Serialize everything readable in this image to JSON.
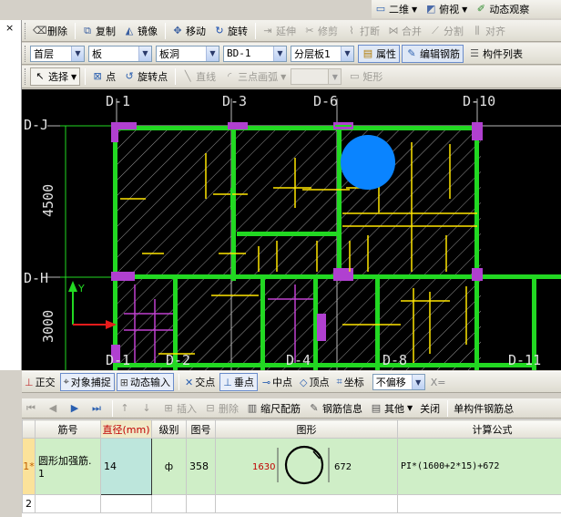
{
  "top_bar": {
    "view_combo": "二维",
    "view_mode": "俯视",
    "dynamic_observe": "动态观察"
  },
  "edit_bar": {
    "delete": "删除",
    "copy": "复制",
    "mirror": "镜像",
    "move": "移动",
    "rotate": "旋转",
    "extend": "延伸",
    "trim": "修剪",
    "break": "打断",
    "merge": "合并",
    "split": "分割",
    "align": "对齐"
  },
  "prop_bar": {
    "floor": "首层",
    "category": "板",
    "type": "板洞",
    "component": "BD-1",
    "layer": "分层板1",
    "properties": "属性",
    "edit_rebar": "编辑钢筋",
    "component_list": "构件列表"
  },
  "draw_bar": {
    "select": "选择",
    "point": "点",
    "rotate_point": "旋转点",
    "line": "直线",
    "arc": "三点画弧",
    "rect": "矩形"
  },
  "left_strip": {
    "close": "×"
  },
  "drawing": {
    "axis_top": [
      "D-1",
      "D-3",
      "D-6",
      "D-10"
    ],
    "axis_bottom": [
      "D-1",
      "D-2",
      "D-4",
      "D-8",
      "D-11"
    ],
    "axis_left": [
      "D-J",
      "D-H"
    ],
    "dims": [
      "4500",
      "3000"
    ],
    "ucs_y": "Y",
    "colors": {
      "wall": "#22d822",
      "column": "#b040d0",
      "rebar": "#ffe600",
      "opening": "#0a84ff",
      "axis": "#b8b8b8"
    }
  },
  "snap_bar": {
    "ortho": "正交",
    "object_snap": "对象捕捉",
    "dynamic_input": "动态输入",
    "intersection": "交点",
    "perpendicular": "垂点",
    "midpoint": "中点",
    "vertex": "顶点",
    "coordinate": "坐标",
    "offset": "不偏移",
    "x_label": "X="
  },
  "grid_tools": {
    "insert": "插入",
    "delete": "删除",
    "scale_rebar": "缩尺配筋",
    "rebar_info": "钢筋信息",
    "other": "其他",
    "close": "关闭",
    "single_summary": "单构件钢筋总"
  },
  "rebar_table": {
    "headers": [
      "",
      "筋号",
      "直径(mm)",
      "级别",
      "图号",
      "图形",
      "计算公式"
    ],
    "rows": [
      {
        "index": "1*",
        "name": "圆形加强筋.1",
        "diameter": "14",
        "grade": "ф",
        "fig_no": "358",
        "shape_left": "1630",
        "shape_right": "672",
        "formula": "PI*(1600+2*15)+672"
      },
      {
        "index": "2",
        "name": "",
        "diameter": "",
        "grade": "",
        "fig_no": "",
        "shape_left": "",
        "shape_right": "",
        "formula": ""
      }
    ]
  }
}
